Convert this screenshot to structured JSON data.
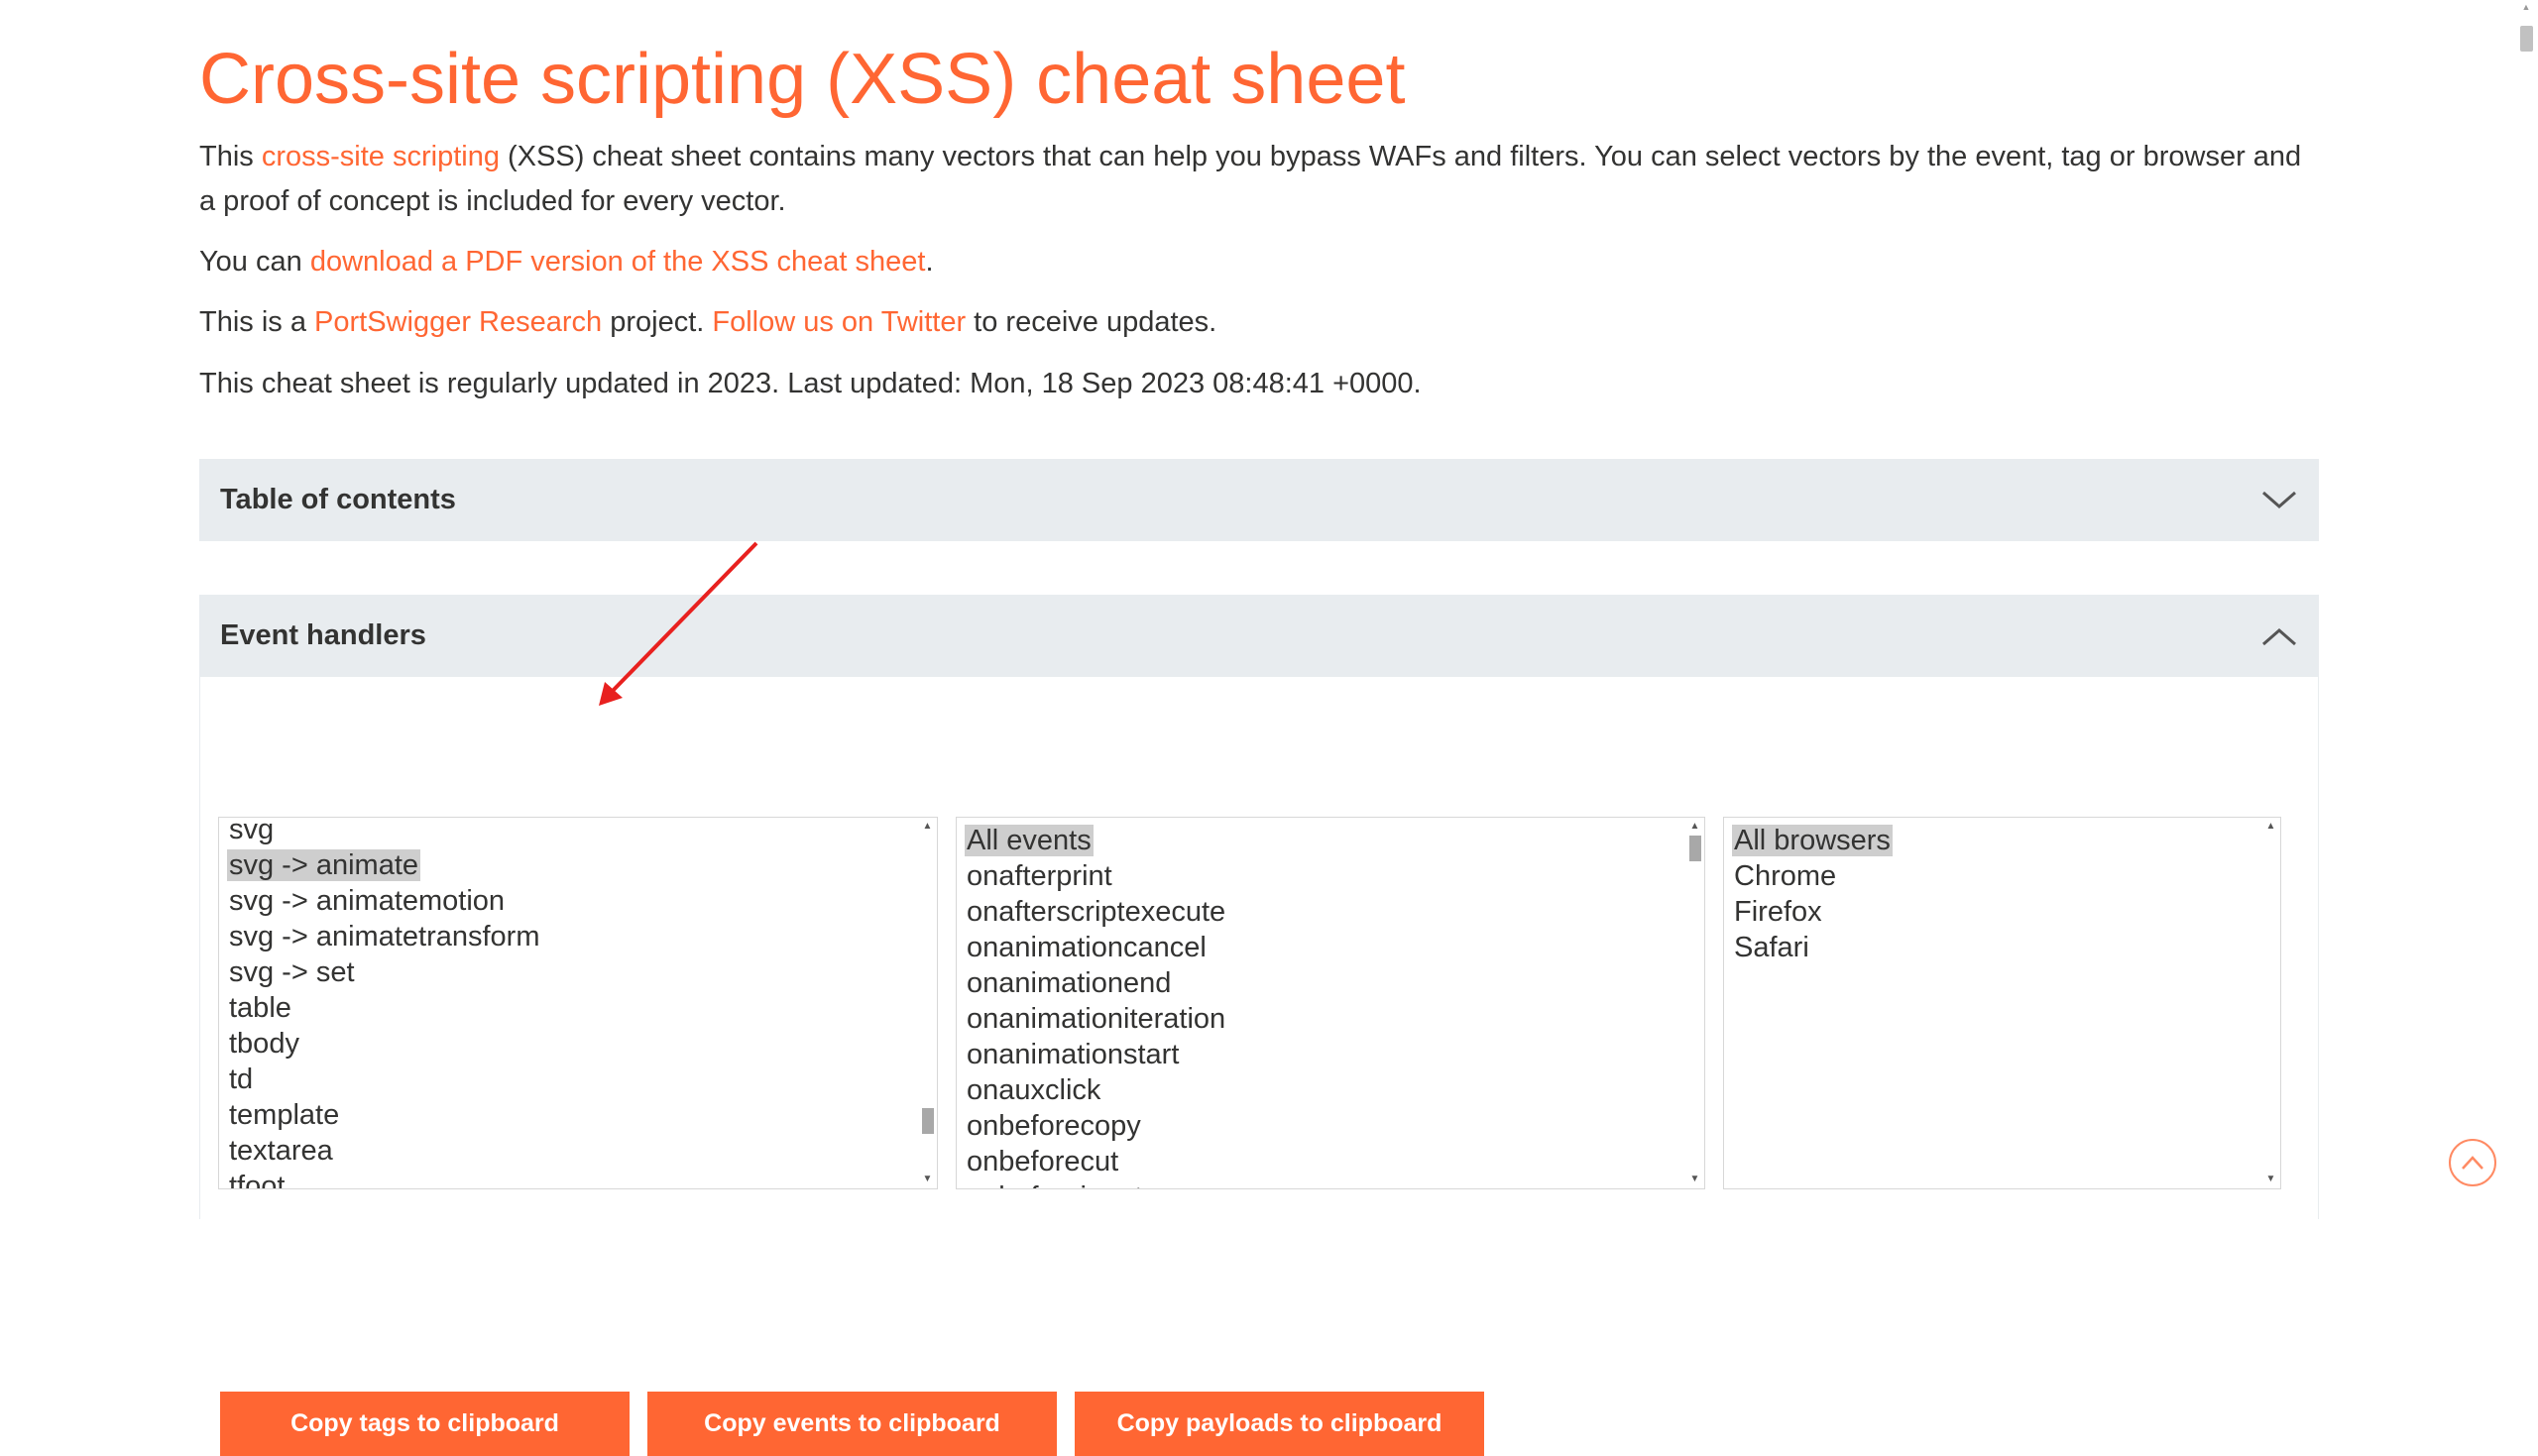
{
  "page": {
    "title": "Cross-site scripting (XSS) cheat sheet",
    "intro": {
      "p1_prefix": "This ",
      "p1_link": "cross-site scripting",
      "p1_suffix": " (XSS) cheat sheet contains many vectors that can help you bypass WAFs and filters. You can select vectors by the event, tag or browser and a proof of concept is included for every vector.",
      "p2_prefix": "You can ",
      "p2_link": "download a PDF version of the XSS cheat sheet",
      "p2_suffix": ".",
      "p3_prefix": "This is a ",
      "p3_link1": "PortSwigger Research",
      "p3_middle": " project. ",
      "p3_link2": "Follow us on Twitter",
      "p3_suffix": " to receive updates.",
      "p4": "This cheat sheet is regularly updated in 2023. Last updated: Mon, 18 Sep 2023 08:48:41 +0000."
    }
  },
  "toc": {
    "title": "Table of contents",
    "icon": "chevron-down-icon"
  },
  "event_handlers": {
    "title": "Event handlers",
    "icon": "chevron-up-icon",
    "buttons": {
      "copy_tags": "Copy tags to clipboard",
      "copy_events": "Copy events to clipboard",
      "copy_payloads": "Copy payloads to clipboard"
    },
    "tags": {
      "items": [
        "svg",
        "svg -> animate",
        "svg -> animatemotion",
        "svg -> animatetransform",
        "svg -> set",
        "table",
        "tbody",
        "td",
        "template",
        "textarea",
        "tfoot"
      ],
      "selected": "svg -> animate",
      "scroll_position": 0.88
    },
    "events": {
      "items": [
        "All events",
        "onafterprint",
        "onafterscriptexecute",
        "onanimationcancel",
        "onanimationend",
        "onanimationiteration",
        "onanimationstart",
        "onauxclick",
        "onbeforecopy",
        "onbeforecut",
        "onbeforeinput"
      ],
      "selected": "All events",
      "scroll_position": 0.0
    },
    "browsers": {
      "items": [
        "All browsers",
        "Chrome",
        "Firefox",
        "Safari"
      ],
      "selected": "All browsers"
    }
  },
  "colors": {
    "accent": "#ff6633",
    "panel_header_bg": "#e8ecef",
    "selection_bg": "#cecece",
    "annotation_arrow": "#e8211f"
  }
}
